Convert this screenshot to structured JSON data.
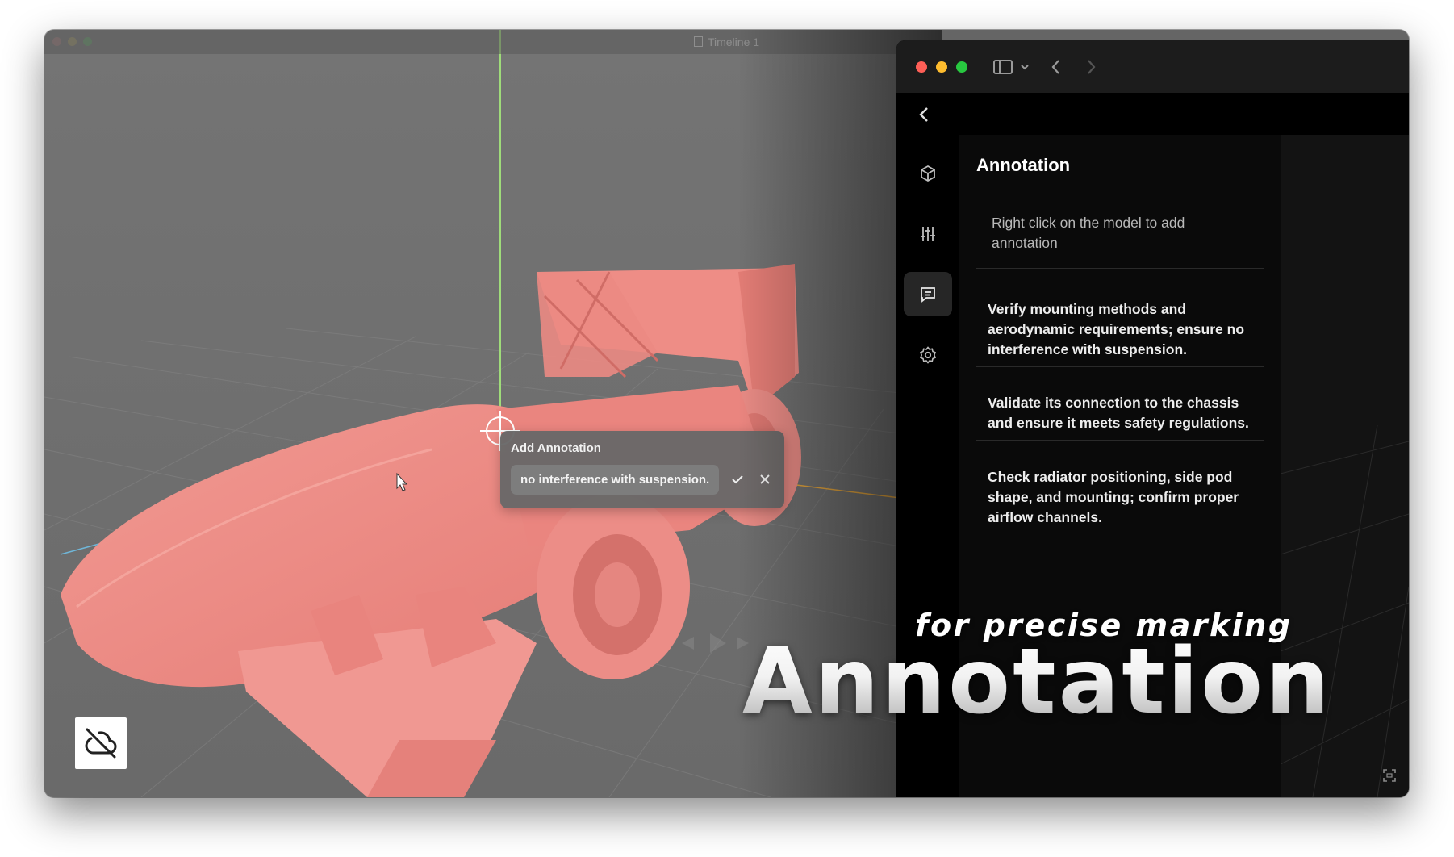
{
  "background_window": {
    "title": "Timeline 1"
  },
  "add_annotation_popup": {
    "title": "Add Annotation",
    "input_value": "no interference with suspension.",
    "confirm_icon": "checkmark-icon",
    "cancel_icon": "close-icon"
  },
  "panel": {
    "titlebar_icons": [
      "sidebar-toggle-icon",
      "chevron-down-icon",
      "back-arrow-icon",
      "forward-arrow-icon"
    ],
    "rail_icons": [
      "cube-icon",
      "sliders-icon",
      "comment-icon",
      "gear-icon"
    ],
    "active_rail_item": "comment-icon",
    "title": "Annotation",
    "hint": "Right click on the model to add annotation",
    "notes": [
      "Verify mounting methods and aerodynamic requirements; ensure no interference with suspension.",
      "Validate its connection to the chassis and ensure it meets safety regulations.",
      "Check radiator positioning, side pod shape, and mounting; confirm proper airflow channels."
    ]
  },
  "caption": {
    "subtitle": "for precise marking",
    "title": "Annotation"
  },
  "colors": {
    "model": "#f08a84",
    "viewport": "#6e6e6e",
    "panel_bg": "#000000",
    "accent_active": "#262626"
  }
}
